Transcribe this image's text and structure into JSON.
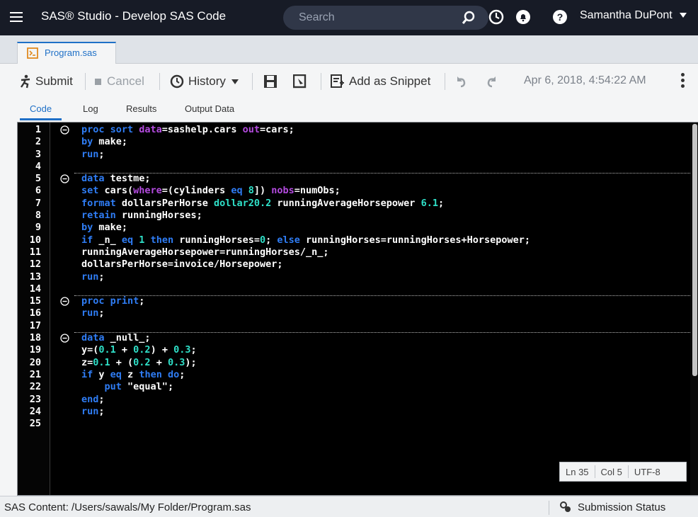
{
  "header": {
    "app_title": "SAS® Studio - Develop SAS Code",
    "search_placeholder": "Search",
    "user": "Samantha DuPont"
  },
  "tabs": [
    {
      "label": "Program.sas"
    }
  ],
  "toolbar": {
    "submit": "Submit",
    "cancel": "Cancel",
    "history": "History",
    "add_snippet": "Add as Snippet",
    "timestamp": "Apr 6, 2018, 4:54:22 AM"
  },
  "subtabs": [
    "Code",
    "Log",
    "Results",
    "Output Data"
  ],
  "editor": {
    "lines": [
      {
        "n": "1",
        "fold": true
      },
      {
        "n": "2"
      },
      {
        "n": "3"
      },
      {
        "n": "4"
      },
      {
        "n": "5",
        "fold": true
      },
      {
        "n": "6"
      },
      {
        "n": "7"
      },
      {
        "n": "8"
      },
      {
        "n": "9"
      },
      {
        "n": "10"
      },
      {
        "n": "11"
      },
      {
        "n": "12"
      },
      {
        "n": "13"
      },
      {
        "n": "14"
      },
      {
        "n": "15",
        "fold": true
      },
      {
        "n": "16"
      },
      {
        "n": "17"
      },
      {
        "n": "18",
        "fold": true
      },
      {
        "n": "19"
      },
      {
        "n": "20"
      },
      {
        "n": "21"
      },
      {
        "n": "22"
      },
      {
        "n": "23"
      },
      {
        "n": "24"
      },
      {
        "n": "25"
      }
    ],
    "code": {
      "l1": [
        [
          "kw",
          "proc sort "
        ],
        [
          "kw2",
          "data"
        ],
        [
          "",
          "=sashelp.cars "
        ],
        [
          "kw2",
          "out"
        ],
        [
          "",
          "=cars;"
        ]
      ],
      "l2": [
        [
          "kw",
          "by "
        ],
        [
          "",
          "make;"
        ]
      ],
      "l3": [
        [
          "kw",
          "run"
        ],
        [
          "",
          ";"
        ]
      ],
      "l4": [],
      "l5": [
        [
          "kw",
          "data "
        ],
        [
          "",
          "testme;"
        ]
      ],
      "l6": [
        [
          "kw",
          "set "
        ],
        [
          "",
          "cars("
        ],
        [
          "kw2",
          "where"
        ],
        [
          "",
          "=(cylinders "
        ],
        [
          "kw",
          "eq "
        ],
        [
          "num",
          "8"
        ],
        [
          "",
          "]) "
        ],
        [
          "kw2",
          "nobs"
        ],
        [
          "",
          "=numObs;"
        ]
      ],
      "l7": [
        [
          "kw",
          "format "
        ],
        [
          "",
          "dollarsPerHorse "
        ],
        [
          "fmt",
          "dollar20.2 "
        ],
        [
          "",
          "runningAverageHorsepower "
        ],
        [
          "fmt",
          "6.1"
        ],
        [
          "",
          ";"
        ]
      ],
      "l8": [
        [
          "kw",
          "retain "
        ],
        [
          "",
          "runningHorses;"
        ]
      ],
      "l9": [
        [
          "kw",
          "by "
        ],
        [
          "",
          "make;"
        ]
      ],
      "l10": [
        [
          "kw",
          "if "
        ],
        [
          "",
          "_n_ "
        ],
        [
          "kw",
          "eq "
        ],
        [
          "num",
          "1 "
        ],
        [
          "kw",
          "then "
        ],
        [
          "",
          "runningHorses="
        ],
        [
          "num",
          "0"
        ],
        [
          "",
          "; "
        ],
        [
          "kw",
          "else "
        ],
        [
          "",
          "runningHorses=runningHorses+Horsepower;"
        ]
      ],
      "l11": [
        [
          "",
          "runningAverageHorsepower=runningHorses/_n_;"
        ]
      ],
      "l12": [
        [
          "",
          "dollarsPerHorse=invoice/Horsepower;"
        ]
      ],
      "l13": [
        [
          "kw",
          "run"
        ],
        [
          "",
          ";"
        ]
      ],
      "l14": [],
      "l15": [
        [
          "kw",
          "proc print"
        ],
        [
          "",
          ";"
        ]
      ],
      "l16": [
        [
          "kw",
          "run"
        ],
        [
          "",
          ";"
        ]
      ],
      "l17": [],
      "l18": [
        [
          "kw",
          "data "
        ],
        [
          "",
          "_null_;"
        ]
      ],
      "l19": [
        [
          "",
          "y=("
        ],
        [
          "num",
          "0.1 "
        ],
        [
          "",
          "+ "
        ],
        [
          "num",
          "0.2"
        ],
        [
          "",
          ") + "
        ],
        [
          "num",
          "0.3"
        ],
        [
          "",
          ";"
        ]
      ],
      "l20": [
        [
          "",
          "z="
        ],
        [
          "num",
          "0.1 "
        ],
        [
          "",
          "+ ("
        ],
        [
          "num",
          "0.2 "
        ],
        [
          "",
          "+ "
        ],
        [
          "num",
          "0.3"
        ],
        [
          "",
          ");"
        ]
      ],
      "l21": [
        [
          "kw",
          "if "
        ],
        [
          "",
          "y "
        ],
        [
          "kw",
          "eq "
        ],
        [
          "",
          "z "
        ],
        [
          "kw",
          "then do"
        ],
        [
          "",
          ";"
        ]
      ],
      "l22": [
        [
          "",
          "    "
        ],
        [
          "kw",
          "put "
        ],
        [
          "str",
          "\"equal\""
        ],
        [
          "",
          ";"
        ]
      ],
      "l23": [
        [
          "kw",
          "end"
        ],
        [
          "",
          ";"
        ]
      ],
      "l24": [
        [
          "kw",
          "run"
        ],
        [
          "",
          ";"
        ]
      ],
      "l25": []
    },
    "status": {
      "ln": "Ln 35",
      "col": "Col 5",
      "enc": "UTF-8"
    }
  },
  "bottom": {
    "path": "SAS Content: /Users/sawals/My Folder/Program.sas",
    "submission_status": "Submission Status"
  }
}
